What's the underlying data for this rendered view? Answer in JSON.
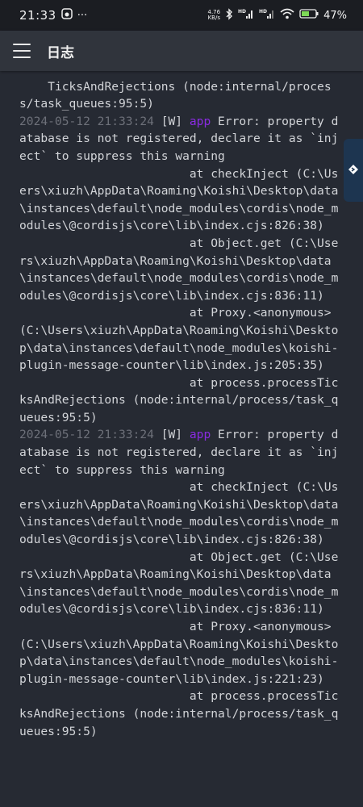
{
  "status_bar": {
    "time": "21:33",
    "overflow": "···",
    "speed_value": "4.76",
    "speed_unit": "KB/s",
    "battery": "47%"
  },
  "app_bar": {
    "title": "日志"
  },
  "log": {
    "head_fragment": "TicksAndRejections (node:internal/process/task_queues:95:5)",
    "entries": [
      {
        "timestamp": "2024-05-12 21:33:24",
        "level": "[W]",
        "tag": "app",
        "message": " Error: property database is not registered, declare it as `inject` to suppress this warning",
        "stack": [
          "                        at checkInject (C:\\Users\\xiuzh\\AppData\\Roaming\\Koishi\\Desktop\\data\\instances\\default\\node_modules\\cordis\\node_modules\\@cordisjs\\core\\lib\\index.cjs:826:38)",
          "                        at Object.get (C:\\Users\\xiuzh\\AppData\\Roaming\\Koishi\\Desktop\\data\\instances\\default\\node_modules\\cordis\\node_modules\\@cordisjs\\core\\lib\\index.cjs:836:11)",
          "                        at Proxy.<anonymous> (C:\\Users\\xiuzh\\AppData\\Roaming\\Koishi\\Desktop\\data\\instances\\default\\node_modules\\koishi-plugin-message-counter\\lib\\index.js:205:35)",
          "                        at process.processTicksAndRejections (node:internal/process/task_queues:95:5)"
        ]
      },
      {
        "timestamp": "2024-05-12 21:33:24",
        "level": "[W]",
        "tag": "app",
        "message": " Error: property database is not registered, declare it as `inject` to suppress this warning",
        "stack": [
          "                        at checkInject (C:\\Users\\xiuzh\\AppData\\Roaming\\Koishi\\Desktop\\data\\instances\\default\\node_modules\\cordis\\node_modules\\@cordisjs\\core\\lib\\index.cjs:826:38)",
          "                        at Object.get (C:\\Users\\xiuzh\\AppData\\Roaming\\Koishi\\Desktop\\data\\instances\\default\\node_modules\\cordis\\node_modules\\@cordisjs\\core\\lib\\index.cjs:836:11)",
          "                        at Proxy.<anonymous> (C:\\Users\\xiuzh\\AppData\\Roaming\\Koishi\\Desktop\\data\\instances\\default\\node_modules\\koishi-plugin-message-counter\\lib\\index.js:221:23)",
          "                        at process.processTicksAndRejections (node:internal/process/task_queues:95:5)"
        ]
      }
    ]
  },
  "colors": {
    "background": "#262a33",
    "app_bar": "#30343c",
    "timestamp": "#6d7079",
    "tag": "#8a2be2",
    "side_tab": "#1d3550"
  },
  "icons": {
    "menu": "menu-icon",
    "side_tab": "koishi-icon"
  }
}
